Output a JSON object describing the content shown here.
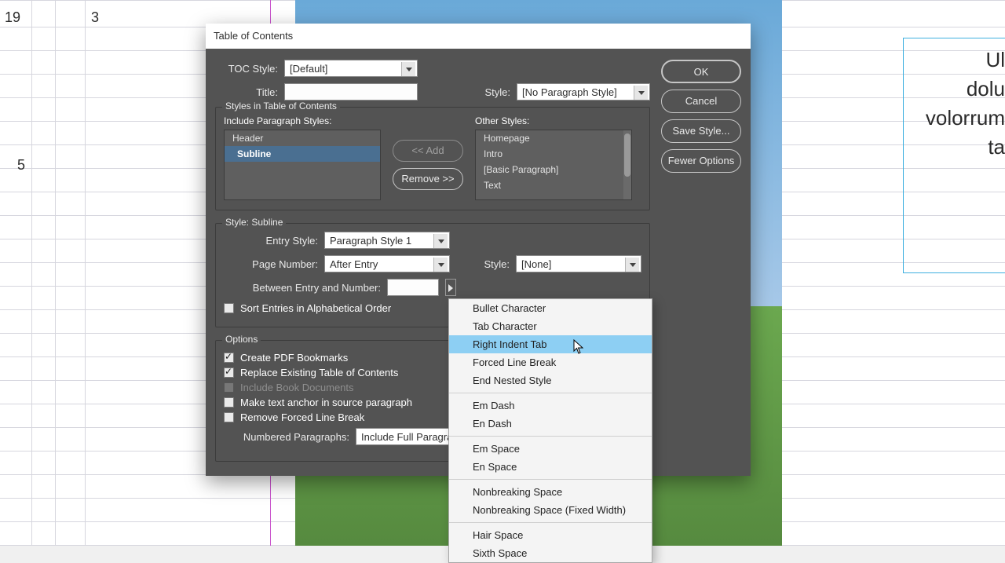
{
  "ruler": {
    "n19": "19",
    "n3": "3",
    "n5": "5"
  },
  "doc_text": {
    "l1": "Ul",
    "l2": "dolu",
    "l3": "volorrum",
    "l4": "ta"
  },
  "dialog": {
    "title": "Table of Contents",
    "toc_style_label": "TOC Style:",
    "toc_style_value": "[Default]",
    "title_label": "Title:",
    "title_value": "",
    "title_style_label": "Style:",
    "title_style_value": "[No Paragraph Style]",
    "buttons": {
      "ok": "OK",
      "cancel": "Cancel",
      "save_style": "Save Style...",
      "fewer_options": "Fewer Options"
    },
    "styles_group": {
      "legend": "Styles in Table of Contents",
      "include_label": "Include Paragraph Styles:",
      "other_label": "Other Styles:",
      "include_items": [
        "Header",
        "Subline"
      ],
      "include_selected_index": 1,
      "other_items": [
        "Homepage",
        "Intro",
        "[Basic Paragraph]",
        "Text"
      ],
      "add": "<< Add",
      "remove": "Remove >>"
    },
    "style_detail": {
      "legend": "Style: Subline",
      "entry_style_label": "Entry Style:",
      "entry_style_value": "Paragraph Style 1",
      "page_number_label": "Page Number:",
      "page_number_value": "After Entry",
      "pn_style_label": "Style:",
      "pn_style_value": "[None]",
      "between_label": "Between Entry and Number:",
      "between_value": "",
      "sort_alpha": "Sort Entries in Alphabetical Order"
    },
    "options_group": {
      "legend": "Options",
      "create_pdf_bookmarks": "Create PDF Bookmarks",
      "replace_existing": "Replace Existing Table of Contents",
      "include_book": "Include Book Documents",
      "make_anchor": "Make text anchor in source paragraph",
      "remove_forced_break": "Remove Forced Line Break",
      "numbered_para_label": "Numbered Paragraphs:",
      "numbered_para_value": "Include Full Paragra"
    }
  },
  "scmenu": {
    "items_g1": [
      "Bullet Character",
      "Tab Character",
      "Right Indent Tab",
      "Forced Line Break",
      "End Nested Style"
    ],
    "items_g2": [
      "Em Dash",
      "En Dash"
    ],
    "items_g3": [
      "Em Space",
      "En Space"
    ],
    "items_g4": [
      "Nonbreaking Space",
      "Nonbreaking Space (Fixed Width)"
    ],
    "items_g5": [
      "Hair Space",
      "Sixth Space"
    ],
    "highlight_index": 2
  }
}
